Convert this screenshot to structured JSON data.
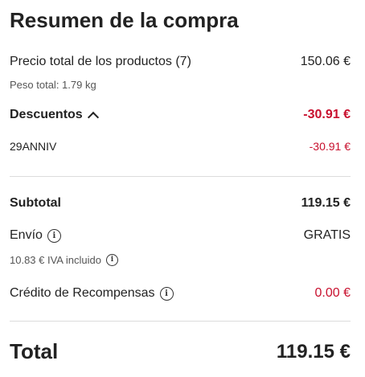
{
  "summary": {
    "title": "Resumen de la compra",
    "products": {
      "label": "Precio total de los productos (7)",
      "value": "150.06 €"
    },
    "weight": "Peso total: 1.79 kg",
    "discounts": {
      "label": "Descuentos",
      "value": "-30.91 €",
      "icon": "chevron-up-icon"
    },
    "coupon": {
      "label": "29ANNIV",
      "value": "-30.91 €"
    },
    "subtotal": {
      "label": "Subtotal",
      "value": "119.15 €"
    },
    "shipping": {
      "label": "Envío",
      "value": "GRATIS",
      "icon": "info-icon"
    },
    "vat": {
      "label": "10.83 € IVA incluido",
      "icon": "info-icon"
    },
    "rewards": {
      "label": "Crédito de Recompensas",
      "value": "0.00 €",
      "icon": "info-icon"
    },
    "total": {
      "label": "Total",
      "value": "119.15 €"
    }
  },
  "colors": {
    "accent_red": "#c8102e",
    "text": "#222222",
    "divider": "#dcdcdc"
  }
}
